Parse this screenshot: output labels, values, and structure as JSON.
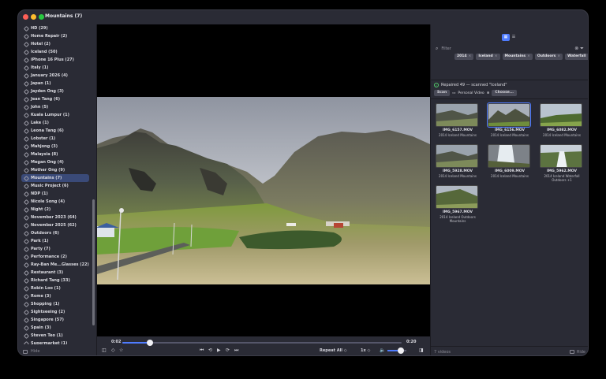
{
  "window": {
    "title": "Mountains (7)"
  },
  "sidebar": {
    "tags": [
      "HD (29)",
      "Home Repair (2)",
      "Hotel (2)",
      "Iceland (50)",
      "iPhone 16 Plus (27)",
      "Italy (1)",
      "January 2026 (4)",
      "Japan (1)",
      "Jayden Ong (3)",
      "Jean Tang (6)",
      "John (5)",
      "Kuala Lumpur (1)",
      "Lake (1)",
      "Leona Tang (6)",
      "Lobster (1)",
      "Mahjong (3)",
      "Malaysia (8)",
      "Megan Ong (4)",
      "Mother Ong (9)",
      "Mountains (7)",
      "Music Project (6)",
      "NDP (1)",
      "Nicole Song (4)",
      "Night (2)",
      "November 2023 (64)",
      "November 2025 (62)",
      "Outdoors (6)",
      "Park (1)",
      "Party (7)",
      "Performance (2)",
      "Ray-Ban Me...Glasses (22)",
      "Restaurant (3)",
      "Richard Tang (33)",
      "Robin Loo (1)",
      "Rome (3)",
      "Shopping (1)",
      "Sightseeing (2)",
      "Singapore (57)",
      "Spain (3)",
      "Steven Teo (1)",
      "Supermarket (1)"
    ],
    "selected_index": 19,
    "footer_label": "Hide"
  },
  "player": {
    "current_time": "0:02",
    "duration": "0:20",
    "progress": 0.1,
    "repeat_label": "Repeat All ◇",
    "speed_label": "1x ◇",
    "volume": 0.7
  },
  "panel": {
    "filter_placeholder": "Filter",
    "chips": [
      "2014",
      "Iceland",
      "Mountains",
      "Outdoors",
      "Waterfall"
    ],
    "status_text": "Repaired 49 — scanned \"Iceland\"",
    "scan_label": "Scan",
    "scan_target": "Personal Video",
    "choose_label": "Choose...",
    "videos": [
      {
        "name": "IMG_6157.MOV",
        "tags": "2014  Iceland  Mountains",
        "selected": false,
        "scene": "cliff"
      },
      {
        "name": "IMG_6156.MOV",
        "tags": "2014  Iceland  Mountains",
        "selected": true,
        "scene": "mountain"
      },
      {
        "name": "IMG_6082.MOV",
        "tags": "2014  Iceland  Mountains",
        "selected": false,
        "scene": "green"
      },
      {
        "name": "IMG_5928.MOV",
        "tags": "2014  Iceland  Mountains",
        "selected": false,
        "scene": "cliff"
      },
      {
        "name": "IMG_6009.MOV",
        "tags": "2014  Iceland  Mountains",
        "selected": false,
        "scene": "waterfall"
      },
      {
        "name": "IMG_5962.MOV",
        "tags": "2014  Iceland  Waterfall  Outdoors  +1",
        "selected": false,
        "scene": "waterfall2"
      },
      {
        "name": "IMG_5967.MOV",
        "tags": "2014  Iceland  Outdoors  Mountains",
        "selected": false,
        "scene": "hill"
      }
    ],
    "count_label": "7 videos",
    "hide_label": "Hide"
  }
}
